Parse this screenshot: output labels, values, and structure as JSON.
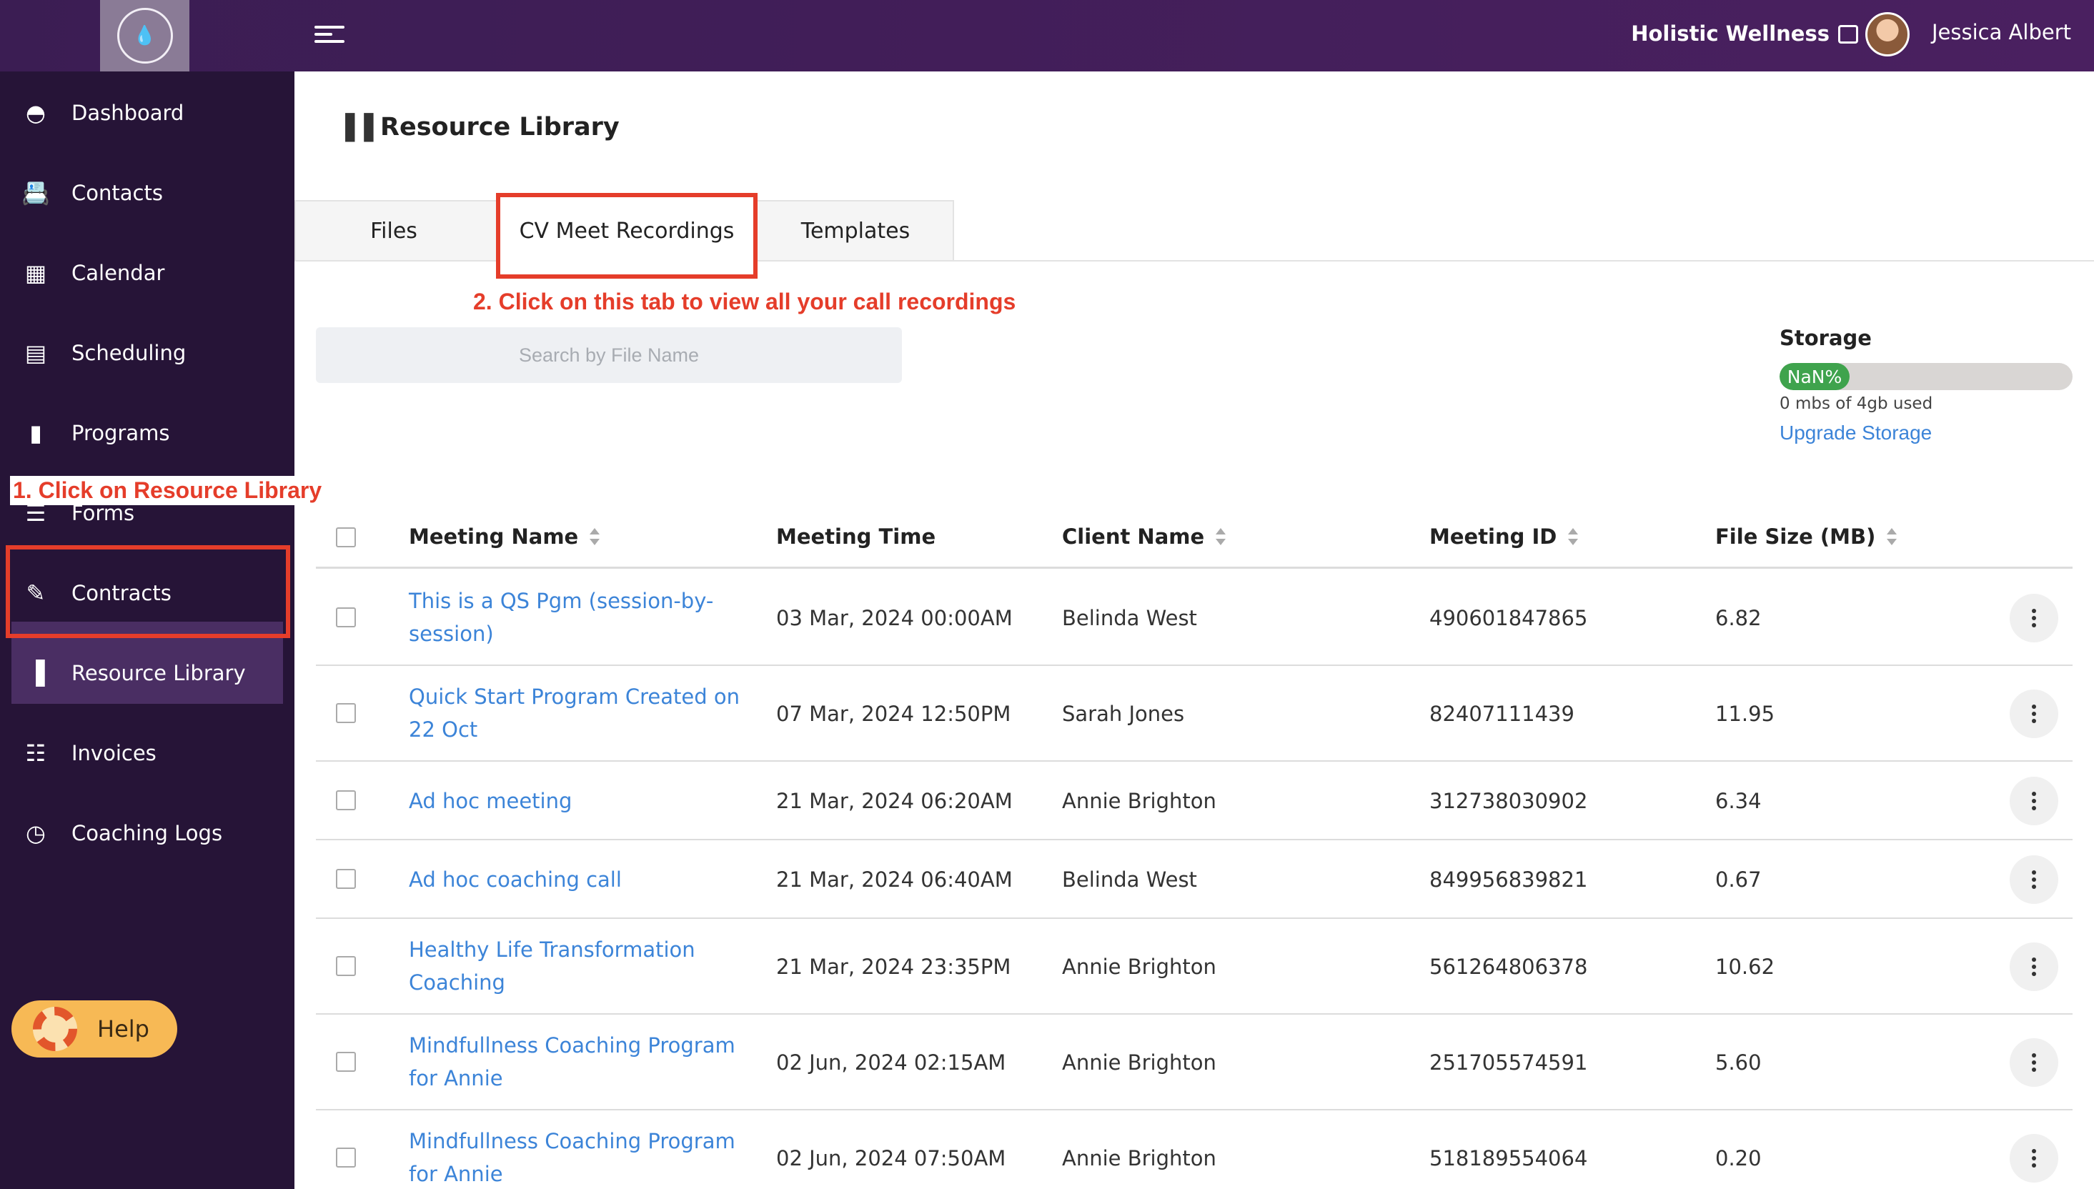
{
  "topbar": {
    "org_name": "Holistic Wellness",
    "user_name": "Jessica Albert"
  },
  "sidebar": {
    "items": [
      {
        "label": "Dashboard",
        "icon": "dashboard-icon"
      },
      {
        "label": "Contacts",
        "icon": "contacts-icon"
      },
      {
        "label": "Calendar",
        "icon": "calendar-icon"
      },
      {
        "label": "Scheduling",
        "icon": "scheduling-icon"
      },
      {
        "label": "Programs",
        "icon": "book-icon"
      },
      {
        "label": "Forms",
        "icon": "forms-icon"
      },
      {
        "label": "Contracts",
        "icon": "contract-icon"
      },
      {
        "label": "Resource Library",
        "icon": "library-icon"
      },
      {
        "label": "Invoices",
        "icon": "invoice-icon"
      },
      {
        "label": "Coaching Logs",
        "icon": "clock-icon"
      }
    ],
    "active_index": 7,
    "help_label": "Help"
  },
  "annotations": {
    "step1": "1. Click on Resource Library",
    "step2": "2. Click on this tab to view all your call recordings"
  },
  "page": {
    "title": "Resource Library"
  },
  "tabs": [
    {
      "label": "Files"
    },
    {
      "label": "CV Meet Recordings"
    },
    {
      "label": "Templates"
    }
  ],
  "search": {
    "placeholder": "Search by File Name",
    "value": ""
  },
  "storage": {
    "title": "Storage",
    "percent_label": "NaN%",
    "used_text": "0 mbs of 4gb used",
    "upgrade_label": "Upgrade Storage",
    "fill_color": "#3fa34d"
  },
  "table": {
    "headers": {
      "meeting_name": "Meeting Name",
      "meeting_time": "Meeting Time",
      "client_name": "Client Name",
      "meeting_id": "Meeting ID",
      "file_size": "File Size (MB)"
    },
    "rows": [
      {
        "name": "This is a QS Pgm (session-by-session)",
        "time": "03 Mar, 2024 00:00AM",
        "client": "Belinda West",
        "id": "490601847865",
        "size": "6.82"
      },
      {
        "name": "Quick Start Program Created on 22 Oct",
        "time": "07 Mar, 2024 12:50PM",
        "client": "Sarah Jones",
        "id": "82407111439",
        "size": "11.95"
      },
      {
        "name": "Ad hoc meeting",
        "time": "21 Mar, 2024 06:20AM",
        "client": "Annie Brighton",
        "id": "312738030902",
        "size": "6.34"
      },
      {
        "name": "Ad hoc coaching call",
        "time": "21 Mar, 2024 06:40AM",
        "client": "Belinda West",
        "id": "849956839821",
        "size": "0.67"
      },
      {
        "name": "Healthy Life Transformation Coaching",
        "time": "21 Mar, 2024 23:35PM",
        "client": "Annie Brighton",
        "id": "561264806378",
        "size": "10.62"
      },
      {
        "name": "Mindfullness Coaching Program for Annie",
        "time": "02 Jun, 2024 02:15AM",
        "client": "Annie Brighton",
        "id": "251705574591",
        "size": "5.60"
      },
      {
        "name": "Mindfullness Coaching Program for Annie",
        "time": "02 Jun, 2024 07:50AM",
        "client": "Annie Brighton",
        "id": "518189554064",
        "size": "0.20"
      }
    ]
  },
  "colors": {
    "topbar": "#3b1d53",
    "sidebar": "#261437",
    "accent_link": "#3c84d8",
    "annotation": "#e53d2a",
    "help_button": "#f7b955"
  }
}
